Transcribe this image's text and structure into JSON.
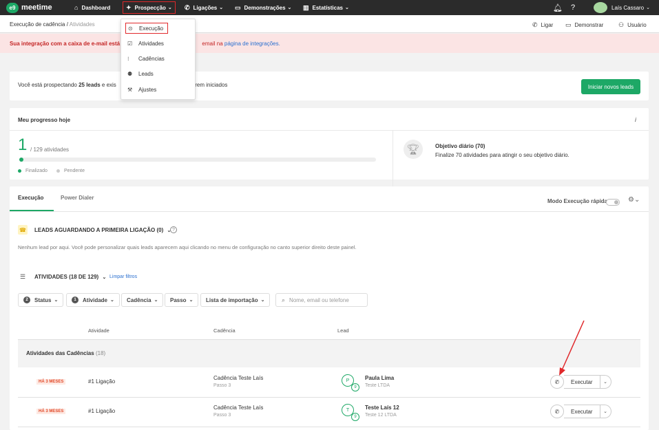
{
  "topbar": {
    "logo_mark": "e9",
    "logo_text": "meetime",
    "nav": {
      "dashboard": "Dashboard",
      "prospeccao": "Prospecção",
      "ligacoes": "Ligações",
      "demonstracoes": "Demonstrações",
      "estatisticas": "Estatísticas"
    },
    "user_name": "Laís Cassaro"
  },
  "subbar": {
    "breadcrumb_root": "Execução de cadência",
    "breadcrumb_sep": "/",
    "breadcrumb_current": "Atividades",
    "actions": {
      "ligar": "Ligar",
      "demonstrar": "Demonstrar",
      "usuario": "Usuário"
    }
  },
  "alert": {
    "bold_prefix": "Sua integração com a caixa de e-mail está in",
    "suffix": "email na",
    "link": "página de integrações."
  },
  "prospect": {
    "text_before": "Você está prospectando",
    "leads_count": "25 leads",
    "text_middle": "e exis",
    "text_after": "serem iniciados",
    "button": "Iniciar novos leads"
  },
  "progress": {
    "title": "Meu progresso hoje",
    "info_icon": "i",
    "done": "1",
    "of_total": "/ 129 atividades",
    "fraction": 0.0078,
    "legend_done": "Finalizado",
    "legend_pending": "Pendente",
    "goal_title": "Objetivo diário (70)",
    "goal_desc": "Finalize 70 atividades para atingir o seu objetivo diário."
  },
  "tabs": {
    "execucao": "Execução",
    "power_dialer": "Power Dialer",
    "quick_mode": "Modo Execução rápida"
  },
  "leads_section": {
    "title": "LEADS AGUARDANDO A PRIMEIRA LIGAÇÃO (0)",
    "description": "Nenhum lead por aqui. Você pode personalizar quais leads aparecem aqui clicando no menu de configuração no canto superior direito deste painel."
  },
  "activities_section": {
    "title": "ATIVIDADES (18 DE 129)",
    "clear_filters": "Limpar filtros",
    "filters": [
      {
        "label": "Status",
        "badge": "2"
      },
      {
        "label": "Atividade",
        "badge": "1"
      },
      {
        "label": "Cadência",
        "badge": ""
      },
      {
        "label": "Passo",
        "badge": ""
      },
      {
        "label": "Lista de importação",
        "badge": ""
      }
    ],
    "search_placeholder": "Nome, email ou telefone"
  },
  "table": {
    "headers": {
      "atividade": "Atividade",
      "cadencia": "Cadência",
      "lead": "Lead"
    },
    "group_label": "Atividades das Cadências",
    "group_count": "(18)",
    "rows": [
      {
        "tag": "HÁ 3 MESES",
        "activity": "#1 Ligação",
        "cadence": "Cadência Teste Laís",
        "step": "Passo 3",
        "initial": "P",
        "sub": "9",
        "lead_name": "Paula Lima",
        "company": "Teste LTDA",
        "action": "Executar"
      },
      {
        "tag": "HÁ 3 MESES",
        "activity": "#1 Ligação",
        "cadence": "Cadência Teste Laís",
        "step": "Passo 3",
        "initial": "T",
        "sub": "9",
        "lead_name": "Teste Laís 12",
        "company": "Teste 12 LTDA",
        "action": "Executar"
      }
    ]
  },
  "dropdown": {
    "items": [
      {
        "label": "Execução",
        "icon": "play-circle-icon"
      },
      {
        "label": "Atividades",
        "icon": "checkbox-icon"
      },
      {
        "label": "Cadências",
        "icon": "cadence-icon"
      },
      {
        "label": "Leads",
        "icon": "people-icon"
      },
      {
        "label": "Ajustes",
        "icon": "wrench-icon"
      }
    ]
  },
  "colors": {
    "accent": "#1da866",
    "highlight": "#e0282b",
    "topbar": "#2b2b2b"
  }
}
